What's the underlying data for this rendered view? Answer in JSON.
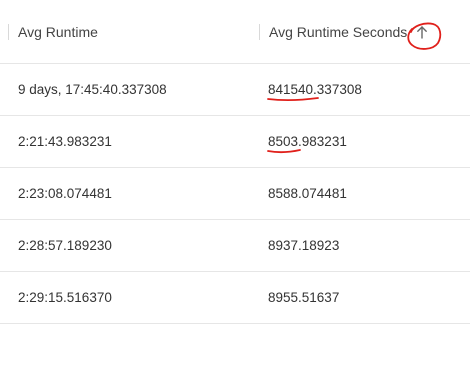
{
  "table": {
    "columns": [
      {
        "label": "Avg Runtime"
      },
      {
        "label": "Avg Runtime Seconds",
        "sort": "ascending",
        "sort_icon": "arrow-up-icon"
      }
    ],
    "rows": [
      {
        "avg_runtime": "9 days, 17:45:40.337308",
        "avg_runtime_seconds": "841540.337308"
      },
      {
        "avg_runtime": "2:21:43.983231",
        "avg_runtime_seconds": "8503.983231"
      },
      {
        "avg_runtime": "2:23:08.074481",
        "avg_runtime_seconds": "8588.074481"
      },
      {
        "avg_runtime": "2:28:57.189230",
        "avg_runtime_seconds": "8937.18923"
      },
      {
        "avg_runtime": "2:29:15.516370",
        "avg_runtime_seconds": "8955.51637"
      }
    ]
  },
  "annotation_color": "#e0201b",
  "colors": {
    "border": "#e6e6e6",
    "text": "#333333",
    "header_text": "#444444",
    "icon": "#666666"
  }
}
